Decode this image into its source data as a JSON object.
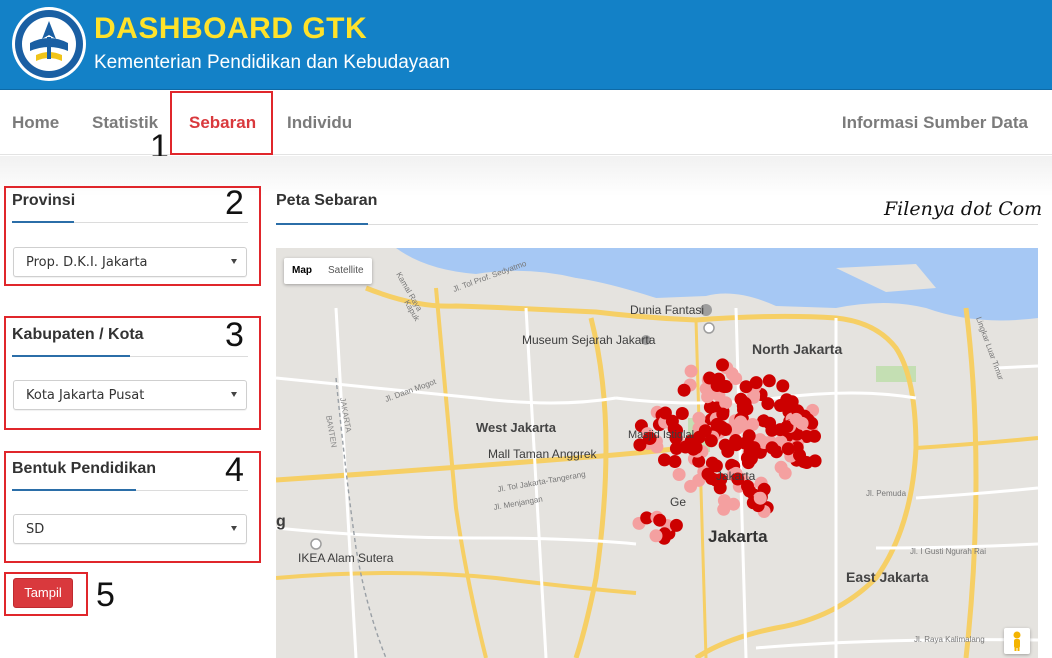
{
  "header": {
    "title": "DASHBOARD GTK",
    "subtitle": "Kementerian Pendidikan dan Kebudayaan",
    "logo_text": "TUT WURI HANDAYANI"
  },
  "nav": {
    "items": [
      {
        "label": "Home"
      },
      {
        "label": "Statistik"
      },
      {
        "label": "Sebaran",
        "active": true
      },
      {
        "label": "Individu"
      }
    ],
    "right": "Informasi Sumber Data"
  },
  "annotations": [
    "1",
    "2",
    "3",
    "4",
    "5"
  ],
  "filters": {
    "provinsi": {
      "title": "Provinsi",
      "value": "Prop. D.K.I. Jakarta"
    },
    "kabupaten": {
      "title": "Kabupaten / Kota",
      "value": "Kota Jakarta Pusat"
    },
    "bentuk": {
      "title": "Bentuk Pendidikan",
      "value": "SD"
    },
    "button": "Tampil"
  },
  "map": {
    "title": "Peta Sebaran",
    "watermark": "Filenya dot Com",
    "toggle": [
      "Map",
      "Satellite"
    ],
    "labels": {
      "dunia_fantasi": "Dunia Fantasi",
      "museum": "Museum Sejarah Jakarta",
      "north": "North Jakarta",
      "west": "West Jakarta",
      "mall": "Mall Taman Anggrek",
      "jakarta": "Jakarta",
      "east": "East Jakarta",
      "ikea": "IKEA Alam Sutera",
      "masjid": "Masjid Istiqlal",
      "jakarta_small": "Jakarta",
      "gelora": "Ge",
      "g": "g",
      "kapuk": "Kapuk",
      "kamal": "Kamal Raya",
      "sedyatmo": "Jl. Tol Prof. Sedyatmo",
      "tangerang": "Jl. Tol Jakarta-Tangerang",
      "daan": "Jl. Daan Mogot",
      "menjangan": "Jl. Menjangan",
      "gusti": "Jl. I Gusti Ngurah Rai",
      "pemuda": "Jl. Pemuda",
      "kalimalang": "Jl. Raya Kalimalang",
      "lingkar": "Lingkar Luar Timur",
      "banten": "BANTEN",
      "jakarta_prov": "JAKARTA"
    },
    "accent_dark": "#cc0000",
    "accent_light": "#f4a0a0"
  }
}
